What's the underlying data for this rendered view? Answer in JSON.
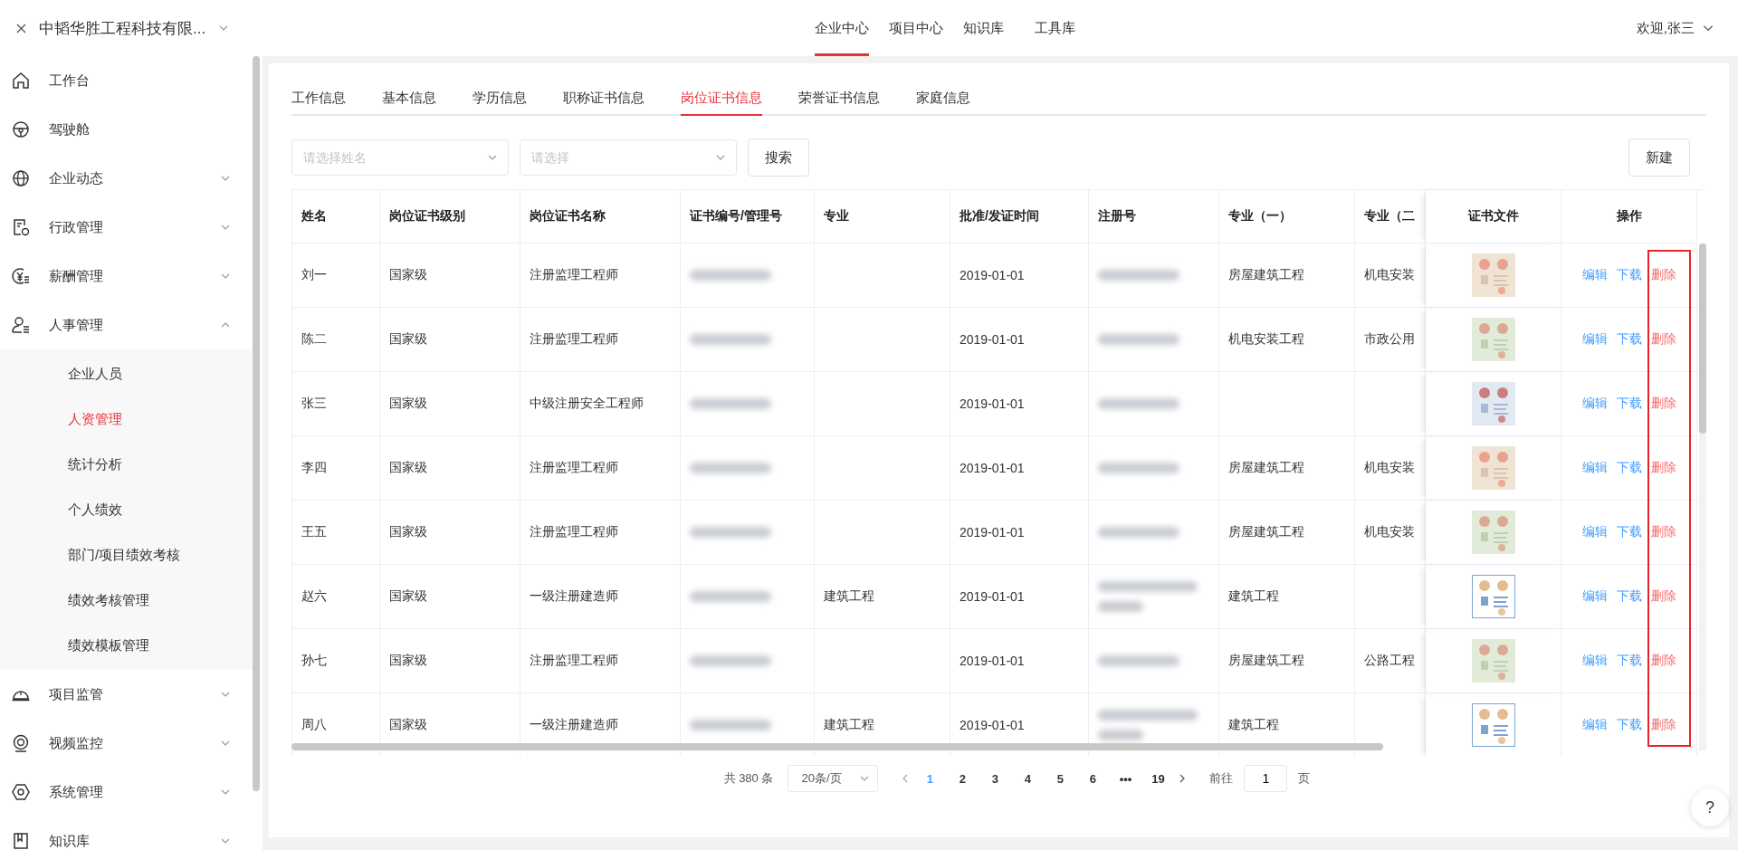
{
  "header": {
    "company": "中韬华胜工程科技有限...",
    "nav": [
      {
        "label": "企业中心",
        "selected": true
      },
      {
        "label": "项目中心",
        "selected": false
      },
      {
        "label": "知识库",
        "selected": false
      },
      {
        "label": "工具库",
        "selected": false
      }
    ],
    "user": "欢迎,张三"
  },
  "sidebar": {
    "items": [
      {
        "label": "工作台"
      },
      {
        "label": "驾驶舱"
      },
      {
        "label": "企业动态",
        "expanded": false
      },
      {
        "label": "行政管理",
        "expanded": false
      },
      {
        "label": "薪酬管理",
        "expanded": false
      },
      {
        "label": "人事管理",
        "expanded": true,
        "children": [
          {
            "label": "企业人员",
            "selected": false
          },
          {
            "label": "人资管理",
            "selected": true
          },
          {
            "label": "统计分析",
            "selected": false
          },
          {
            "label": "个人绩效",
            "selected": false
          },
          {
            "label": "部门/项目绩效考核",
            "selected": false
          },
          {
            "label": "绩效考核管理",
            "selected": false
          },
          {
            "label": "绩效模板管理",
            "selected": false
          }
        ]
      },
      {
        "label": "项目监管",
        "expanded": false
      },
      {
        "label": "视频监控",
        "expanded": false
      },
      {
        "label": "系统管理",
        "expanded": false
      },
      {
        "label": "知识库",
        "expanded": false
      }
    ]
  },
  "tabs": [
    {
      "label": "工作信息",
      "selected": false
    },
    {
      "label": "基本信息",
      "selected": false
    },
    {
      "label": "学历信息",
      "selected": false
    },
    {
      "label": "职称证书信息",
      "selected": false
    },
    {
      "label": "岗位证书信息",
      "selected": true
    },
    {
      "label": "荣誉证书信息",
      "selected": false
    },
    {
      "label": "家庭信息",
      "selected": false
    }
  ],
  "filters": [
    {
      "placeholder": "请选择姓名"
    },
    {
      "placeholder": "请选择"
    }
  ],
  "search_button": "搜索",
  "new_button": "新建",
  "table": {
    "actions_highlighted": true,
    "columns": [
      "姓名",
      "岗位证书级别",
      "岗位证书名称",
      "证书编号/管理号",
      "专业",
      "批准/发证时间",
      "注册号",
      "专业（一）",
      "专业（二",
      "证书文件",
      "操作"
    ],
    "rows": [
      {
        "kind": "plain",
        "name": "刘一",
        "level": "国家级",
        "cert_name": "注册监理工程师",
        "major": "",
        "date": "2019-01-01",
        "major1": "房屋建筑工程",
        "major2": "机电安装",
        "actions": [
          "编辑",
          "下载",
          "删除"
        ]
      },
      {
        "kind": "plain",
        "name": "陈二",
        "level": "国家级",
        "cert_name": "注册监理工程师",
        "major": "",
        "date": "2019-01-01",
        "major1": "机电安装工程",
        "major2": "市政公用",
        "actions": [
          "编辑",
          "下载",
          "删除"
        ]
      },
      {
        "kind": "plain",
        "name": "张三",
        "level": "国家级",
        "cert_name": "中级注册安全工程师",
        "major": "",
        "date": "2019-01-01",
        "major1": "",
        "major2": "",
        "actions": [
          "编辑",
          "下载",
          "删除"
        ]
      },
      {
        "kind": "plain",
        "name": "李四",
        "level": "国家级",
        "cert_name": "注册监理工程师",
        "major": "",
        "date": "2019-01-01",
        "major1": "房屋建筑工程",
        "major2": "机电安装",
        "actions": [
          "编辑",
          "下载",
          "删除"
        ]
      },
      {
        "kind": "plain",
        "name": "王五",
        "level": "国家级",
        "cert_name": "注册监理工程师",
        "major": "",
        "date": "2019-01-01",
        "major1": "房屋建筑工程",
        "major2": "机电安装",
        "actions": [
          "编辑",
          "下载",
          "删除"
        ]
      },
      {
        "kind": "wrapped",
        "name": "赵六",
        "level": "国家级",
        "cert_name": "一级注册建造师",
        "major": "建筑工程",
        "date": "2019-01-01",
        "major1": "建筑工程",
        "major2": "",
        "actions": [
          "编辑",
          "下载",
          "删除"
        ]
      },
      {
        "kind": "plain",
        "name": "孙七",
        "level": "国家级",
        "cert_name": "注册监理工程师",
        "major": "",
        "date": "2019-01-01",
        "major1": "房屋建筑工程",
        "major2": "公路工程",
        "actions": [
          "编辑",
          "下载",
          "删除"
        ]
      },
      {
        "kind": "wrapped",
        "name": "周八",
        "level": "国家级",
        "cert_name": "一级注册建造师",
        "major": "建筑工程",
        "date": "2019-01-01",
        "major1": "建筑工程",
        "major2": "",
        "actions": [
          "编辑",
          "下载",
          "删除"
        ]
      }
    ]
  },
  "pagination": {
    "total": "共 380 条",
    "page_size": "20条/页",
    "pages": [
      {
        "label": "1",
        "selected": true
      },
      {
        "label": "2",
        "selected": false
      },
      {
        "label": "3",
        "selected": false
      },
      {
        "label": "4",
        "selected": false
      },
      {
        "label": "5",
        "selected": false
      },
      {
        "label": "6",
        "selected": false
      },
      {
        "label": "•••",
        "selected": false
      },
      {
        "label": "19",
        "selected": false
      }
    ],
    "goto_label": "前往",
    "goto_value": "1",
    "goto_unit": "页"
  },
  "help_button": "?"
}
